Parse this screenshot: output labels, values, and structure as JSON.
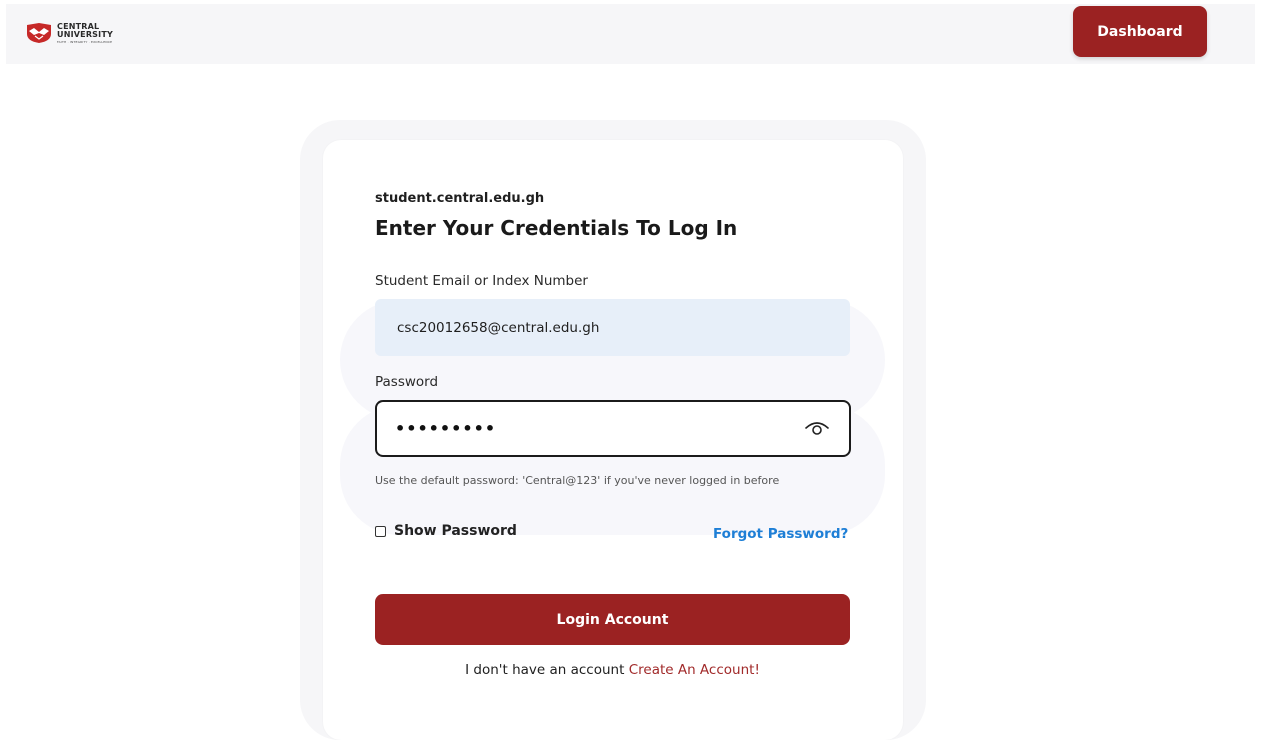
{
  "header": {
    "logo": {
      "name_line1": "CENTRAL",
      "name_line2": "UNIVERSITY",
      "motto": "FAITH · INTEGRITY · EXCELLENCE"
    },
    "dashboard_label": "Dashboard"
  },
  "login": {
    "site": "student.central.edu.gh",
    "title": "Enter Your Credentials To Log In",
    "email_label": "Student Email or Index Number",
    "email_value": "csc20012658@central.edu.gh",
    "password_label": "Password",
    "password_value": "•••••••••",
    "hint": "Use the default password: 'Central@123' if you've never logged in before",
    "show_password_label": "Show Password",
    "forgot_label": "Forgot Password?",
    "login_label": "Login Account",
    "signup_prefix": "I don't have an account",
    "signup_link": "Create An Account!"
  },
  "colors": {
    "brand": "#9b2222",
    "link": "#1e7fd6",
    "input_fill": "#e7eff9"
  },
  "icons": {
    "logo": "university-crest-icon",
    "password_toggle": "eye-icon"
  }
}
